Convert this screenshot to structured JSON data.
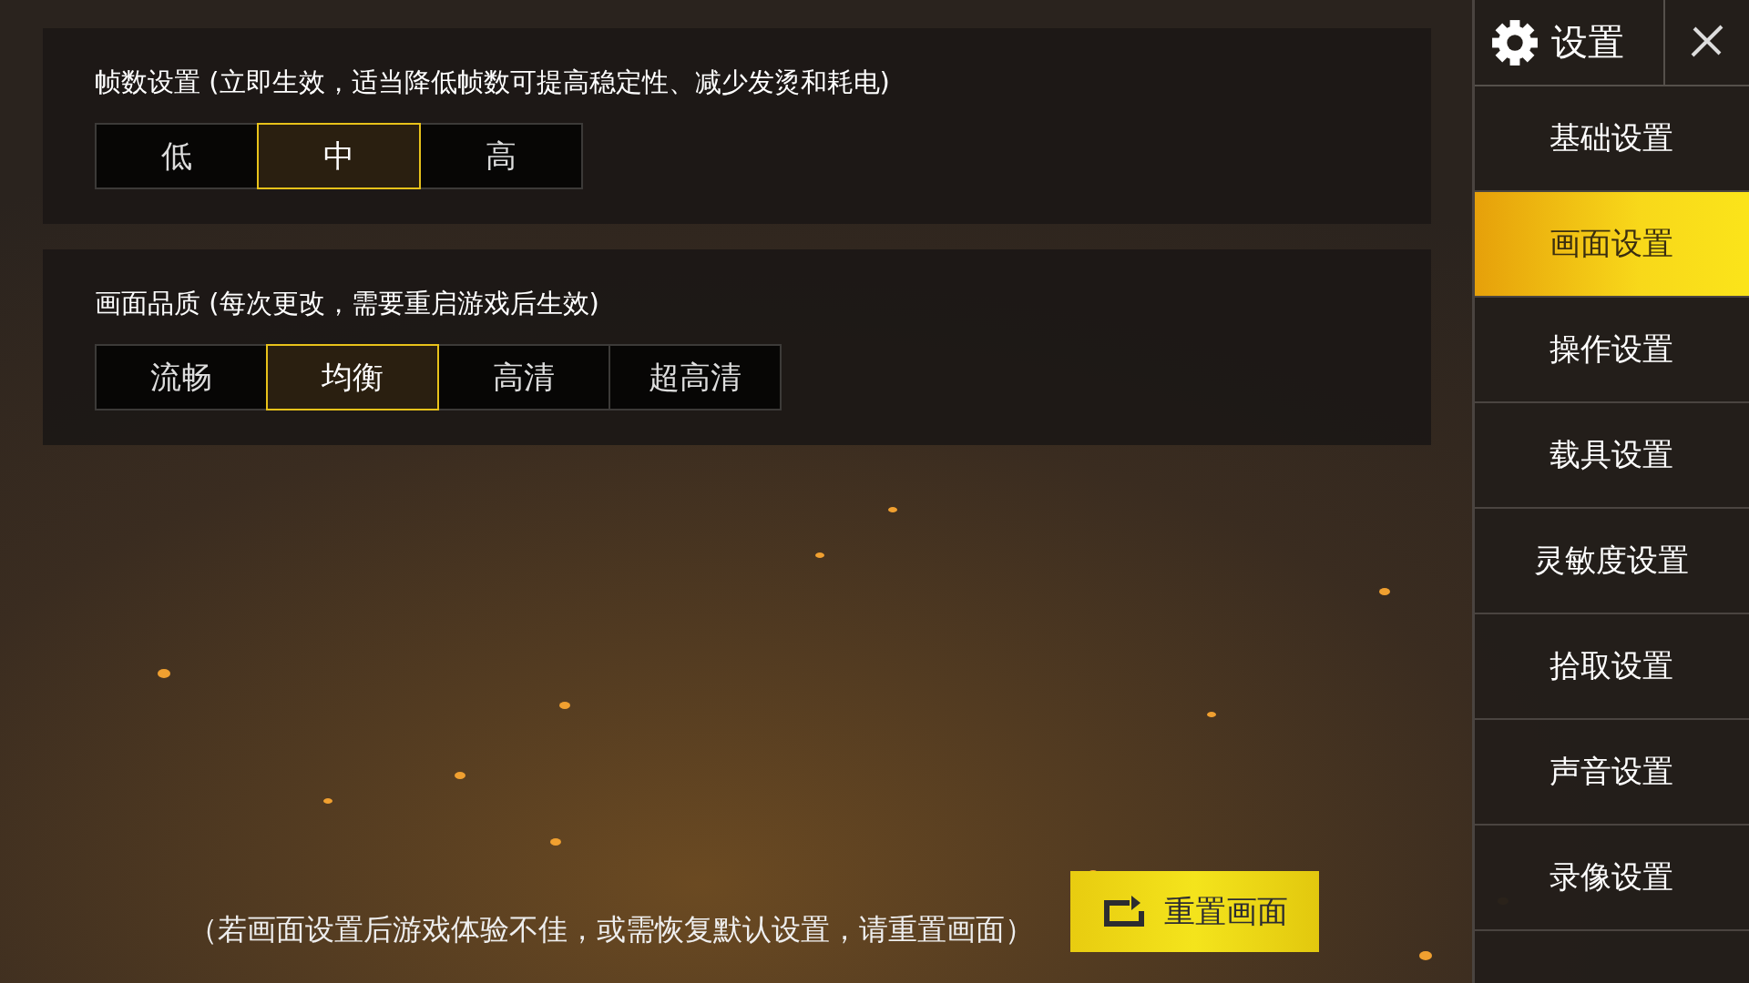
{
  "sidebar": {
    "title": "设置",
    "items": [
      {
        "label": "基础设置",
        "selected": false
      },
      {
        "label": "画面设置",
        "selected": true
      },
      {
        "label": "操作设置",
        "selected": false
      },
      {
        "label": "载具设置",
        "selected": false
      },
      {
        "label": "灵敏度设置",
        "selected": false
      },
      {
        "label": "拾取设置",
        "selected": false
      },
      {
        "label": "声音设置",
        "selected": false
      },
      {
        "label": "录像设置",
        "selected": false
      }
    ]
  },
  "sections": [
    {
      "title": "帧数设置 (立即生效，适当降低帧数可提高稳定性、减少发烫和耗电)",
      "options": [
        {
          "label": "低",
          "selected": false
        },
        {
          "label": "中",
          "selected": true
        },
        {
          "label": "高",
          "selected": false
        }
      ]
    },
    {
      "title": "画面品质 (每次更改，需要重启游戏后生效)",
      "options": [
        {
          "label": "流畅",
          "selected": false
        },
        {
          "label": "均衡",
          "selected": true
        },
        {
          "label": "高清",
          "selected": false
        },
        {
          "label": "超高清",
          "selected": false
        }
      ]
    }
  ],
  "note": "（若画面设置后游戏体验不佳，或需恢复默认设置，请重置画面）",
  "reset_button": "重置画面"
}
